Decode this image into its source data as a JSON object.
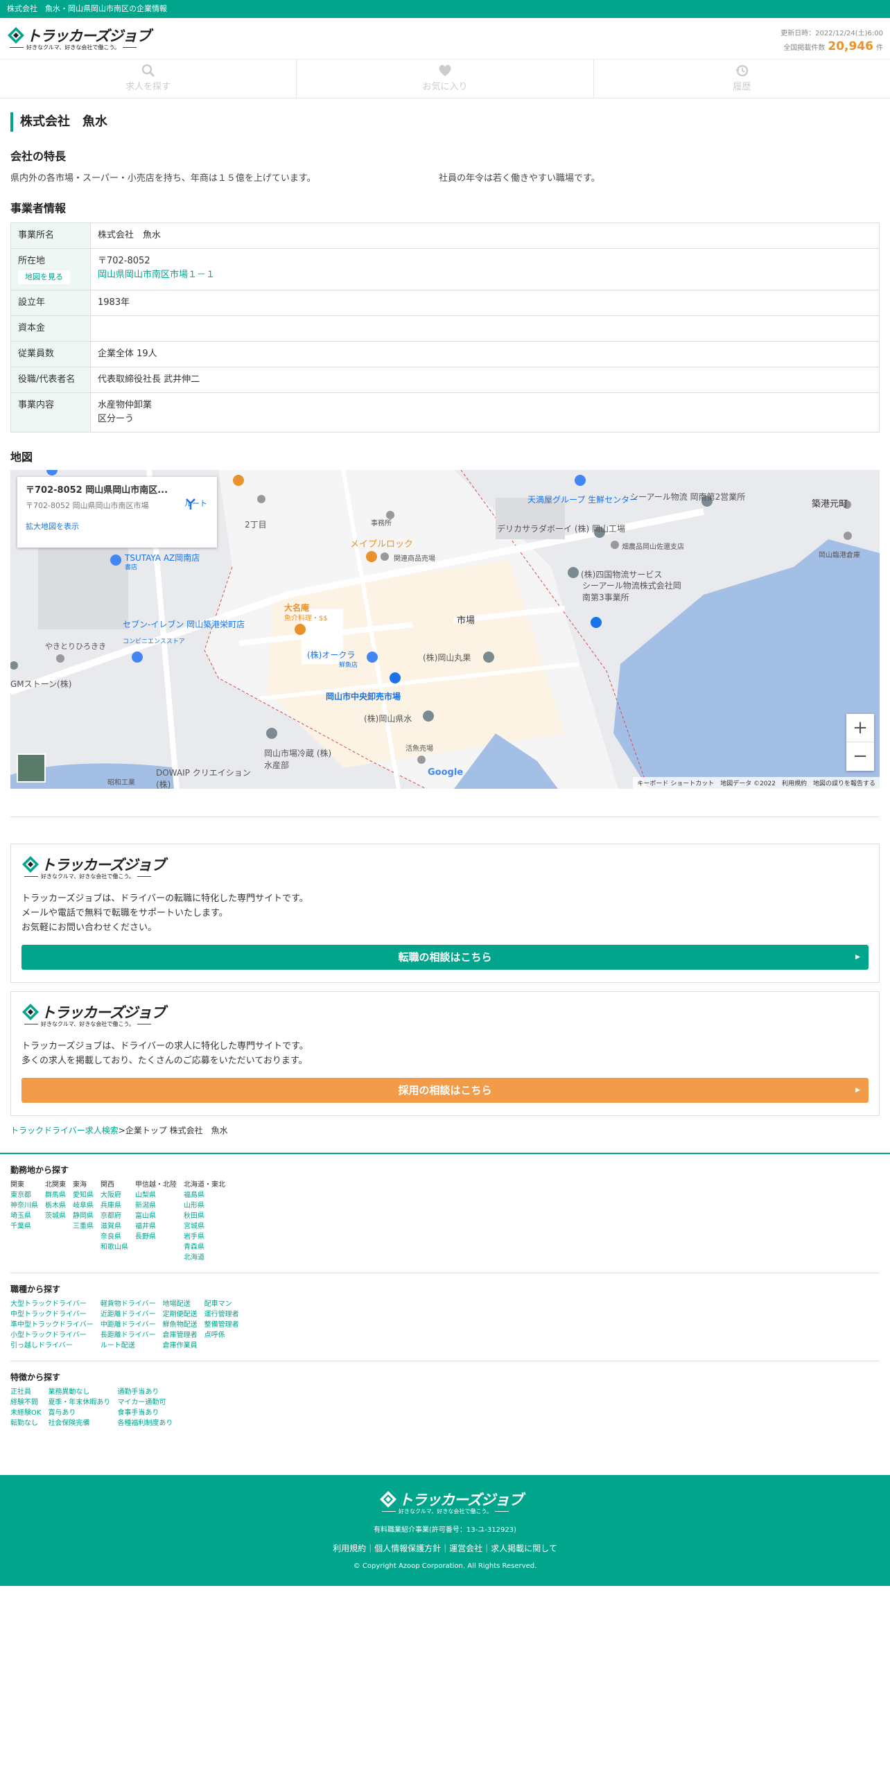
{
  "topbar": "株式会社　魚水・岡山県岡山市南区の企業情報",
  "brand": {
    "name": "トラッカーズジョブ",
    "tagline": "好きなクルマ、好きな会社で働こう。"
  },
  "update": {
    "label": "更新日時：2022/12/24(土)6:00",
    "count_label": "全国掲載件数",
    "count": "20,946",
    "unit": "件"
  },
  "nav": [
    {
      "label": "求人を探す",
      "icon": "search-icon"
    },
    {
      "label": "お気に入り",
      "icon": "heart-icon"
    },
    {
      "label": "履歴",
      "icon": "history-icon"
    }
  ],
  "page_title": "株式会社　魚水",
  "features": {
    "heading": "会社の特長",
    "items": [
      "県内外の各市場・スーパー・小売店を持ち、年商は１５億を上げています。",
      "社員の年令は若く働きやすい職場です。"
    ]
  },
  "business": {
    "heading": "事業者情報",
    "name_label": "事業所名",
    "name": "株式会社　魚水",
    "loc_label": "所在地",
    "map_button": "地図を見る",
    "zip": "〒702-8052",
    "address": "岡山県岡山市南区市場１－１",
    "est_label": "設立年",
    "est": "1983年",
    "capital_label": "資本金",
    "capital": "",
    "emp_label": "従業員数",
    "emp": "企業全体 19人",
    "rep_label": "役職/代表者名",
    "rep": "代表取締役社長 武井伸二",
    "content_label": "事業内容",
    "content1": "水産物仲卸業",
    "content2": "区分ーう"
  },
  "map": {
    "heading": "地図",
    "info_title": "〒702-8052 岡山県岡山市南区...",
    "info_sub": "〒702-8052 岡山県岡山市南区市場",
    "info_link": "拡大地図を表示",
    "route": "ルート",
    "labels": {
      "l1": "天満屋グループ 生鮮センター",
      "l2": "シーアール物流 岡南第2営業所",
      "l3": "築港元町",
      "l4": "メイプルロック",
      "l5": "関連商品売場",
      "l6": "デリカサラダボーイ (株) 岡山工場",
      "l7": "畑農品岡山佐還支店",
      "l8": "(株)四国物流サービス",
      "l9": "シーアール物流株式会社岡南第3事業所",
      "l10": "岡山臨港倉庫",
      "l11": "TSUTAYA AZ岡南店",
      "l12": "大名庵",
      "l13": "魚介料理・$$",
      "l14": "市場",
      "l15": "セブン-イレブン 岡山築港栄町店",
      "l16": "(株)オークラ",
      "l17": "(株)岡山丸果",
      "l18": "岡山市中央卸売市場",
      "l19": "(株)岡山県水",
      "l20": "活魚売場",
      "l21": "岡山市場冷蔵 (株) 水産部",
      "l22": "DOWAIP クリエイション(株)",
      "l23": "やきとりひろきき",
      "l24": "事務所",
      "l25": "2丁目",
      "l26": "鮮魚店",
      "l27": "GMストーン(株)",
      "l28": "昭和工業",
      "l29": "書店",
      "l30": "コンビニエンスストア"
    },
    "google": "Google",
    "attribution": "キーボード ショートカット　地図データ ©2022　利用規約　地図の誤りを報告する"
  },
  "promo1": {
    "text1": "トラッカーズジョブは、ドライバーの転職に特化した専門サイトです。",
    "text2": "メールや電話で無料で転職をサポートいたします。",
    "text3": "お気軽にお問い合わせください。",
    "button": "転職の相談はこちら",
    "color": "#00a58c"
  },
  "promo2": {
    "text1": "トラッカーズジョブは、ドライバーの求人に特化した専門サイトです。",
    "text2": "多くの求人を掲載しており、たくさんのご応募をいただいております。",
    "button": "採用の相談はこちら",
    "color": "#f29b48"
  },
  "breadcrumb": {
    "link": "トラックドライバー求人検索",
    "rest": ">企業トップ 株式会社　魚水"
  },
  "footer": {
    "area_heading": "勤務地から探す",
    "areas": [
      {
        "h": "関東",
        "items": [
          "東京都",
          "神奈川県",
          "埼玉県",
          "千葉県"
        ]
      },
      {
        "h": "北関東",
        "items": [
          "群馬県",
          "栃木県",
          "茨城県"
        ]
      },
      {
        "h": "東海",
        "items": [
          "愛知県",
          "岐阜県",
          "静岡県",
          "三重県"
        ]
      },
      {
        "h": "関西",
        "items": [
          "大阪府",
          "兵庫県",
          "京都府",
          "滋賀県",
          "奈良県",
          "和歌山県"
        ]
      },
      {
        "h": "甲信越・北陸",
        "items": [
          "山梨県",
          "新潟県",
          "富山県",
          "福井県",
          "長野県"
        ]
      },
      {
        "h": "北海道・東北",
        "items": [
          "福島県",
          "山形県",
          "秋田県",
          "宮城県",
          "岩手県",
          "青森県",
          "北海道"
        ]
      }
    ],
    "job_heading": "職種から探す",
    "jobs": [
      [
        "大型トラックドライバー",
        "中型トラックドライバー",
        "準中型トラックドライバー",
        "小型トラックドライバー",
        "引っ越しドライバー"
      ],
      [
        "軽貨物ドライバー",
        "近距離ドライバー",
        "中距離ドライバー",
        "長距離ドライバー",
        "ルート配送"
      ],
      [
        "地場配送",
        "定期便配送",
        "鮮魚物配送",
        "倉庫管理者",
        "倉庫作業員"
      ],
      [
        "配車マン",
        "運行管理者",
        "整備管理者",
        "点呼係"
      ]
    ],
    "feat_heading": "特徴から探す",
    "feats": [
      [
        "正社員",
        "経験不問",
        "未経験OK",
        "転勤なし"
      ],
      [
        "業務異動なし",
        "夏季・年末休暇あり",
        "賞与あり",
        "社会保険完備"
      ],
      [
        "通勤手当あり",
        "マイカー通勤可",
        "食事手当あり",
        "各種福利制度あり"
      ]
    ],
    "license": "有料職業紹介事業(許可番号：13-ユ-312923)",
    "links": "利用規約｜個人情報保護方針｜運営会社｜求人掲載に関して",
    "copyright": "© Copyright Azoop Corporation. All Rights Reserved."
  }
}
